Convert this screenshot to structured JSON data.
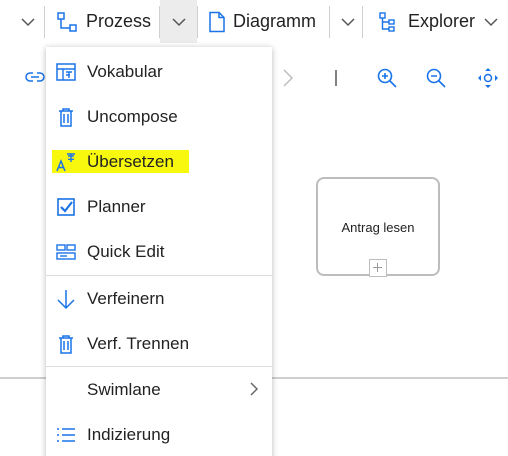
{
  "toolbar": {
    "process_label": "Prozess",
    "diagram_label": "Diagramm",
    "explorer_label": "Explorer"
  },
  "canvas": {
    "task_label": "Antrag lesen"
  },
  "menu": {
    "items": [
      {
        "label": "Vokabular",
        "icon": "vocabulary-icon"
      },
      {
        "label": "Uncompose",
        "icon": "trash-icon"
      },
      {
        "label": "Übersetzen",
        "icon": "translate-icon",
        "highlight": true
      },
      {
        "label": "Planner",
        "icon": "checkbox-icon"
      },
      {
        "label": "Quick Edit",
        "icon": "quick-edit-icon"
      },
      {
        "label": "Verfeinern",
        "icon": "arrow-down-icon"
      },
      {
        "label": "Verf. Trennen",
        "icon": "trash-icon"
      },
      {
        "label": "Swimlane",
        "icon": "chevron-right-icon",
        "submenu": true
      },
      {
        "label": "Indizierung",
        "icon": "list-icon"
      }
    ]
  },
  "colors": {
    "accent": "#1a73e8",
    "highlight": "#ffff00",
    "active_tab_bg": "#ececec"
  }
}
